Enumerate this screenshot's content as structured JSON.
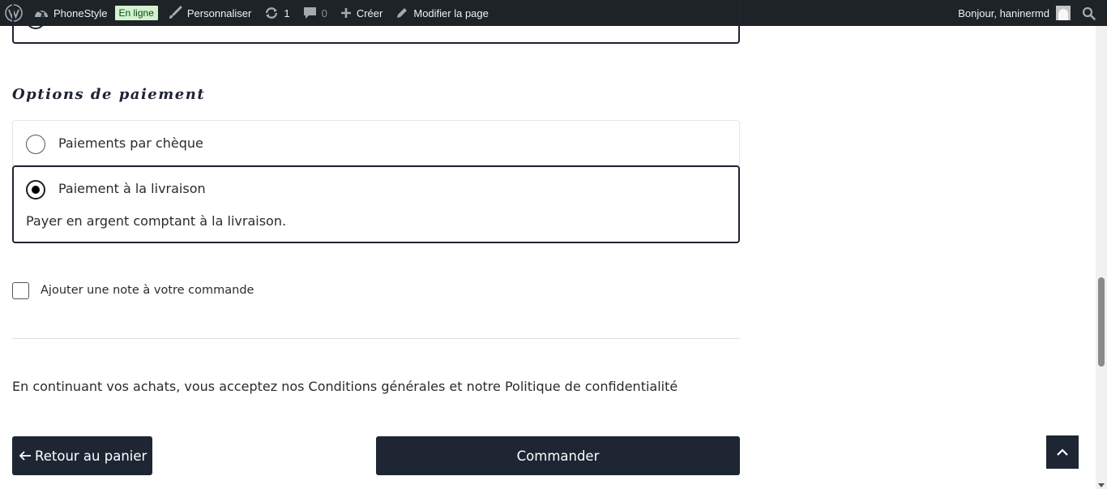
{
  "admin_bar": {
    "site_name": "PhoneStyle",
    "status_badge": "En ligne",
    "customize": "Personnaliser",
    "updates_count": "1",
    "comments_count": "0",
    "create": "Créer",
    "edit_page": "Modifier la page",
    "greeting": "Bonjour, haninermd",
    "icons": [
      "wordpress-logo",
      "dashboard-icon",
      "brush-icon",
      "updates-icon",
      "comment-icon",
      "plus-icon",
      "pencil-icon",
      "avatar",
      "search-icon"
    ]
  },
  "payment": {
    "title": "Options de paiement",
    "options": [
      {
        "label": "Paiements par chèque",
        "selected": false
      },
      {
        "label": "Paiement à la livraison",
        "selected": true,
        "description": "Payer en argent comptant à la livraison."
      }
    ]
  },
  "order_note": {
    "label": "Ajouter une note à votre commande",
    "checked": false
  },
  "terms_text": "En continuant vos achats, vous acceptez nos Conditions générales et notre Politique de confidentialité",
  "actions": {
    "back_label": "Retour au panier",
    "order_label": "Commander"
  },
  "colors": {
    "accent": "#1e2533",
    "admin_bar_bg": "#1d2327",
    "badge_bg": "#d4f1d0"
  }
}
